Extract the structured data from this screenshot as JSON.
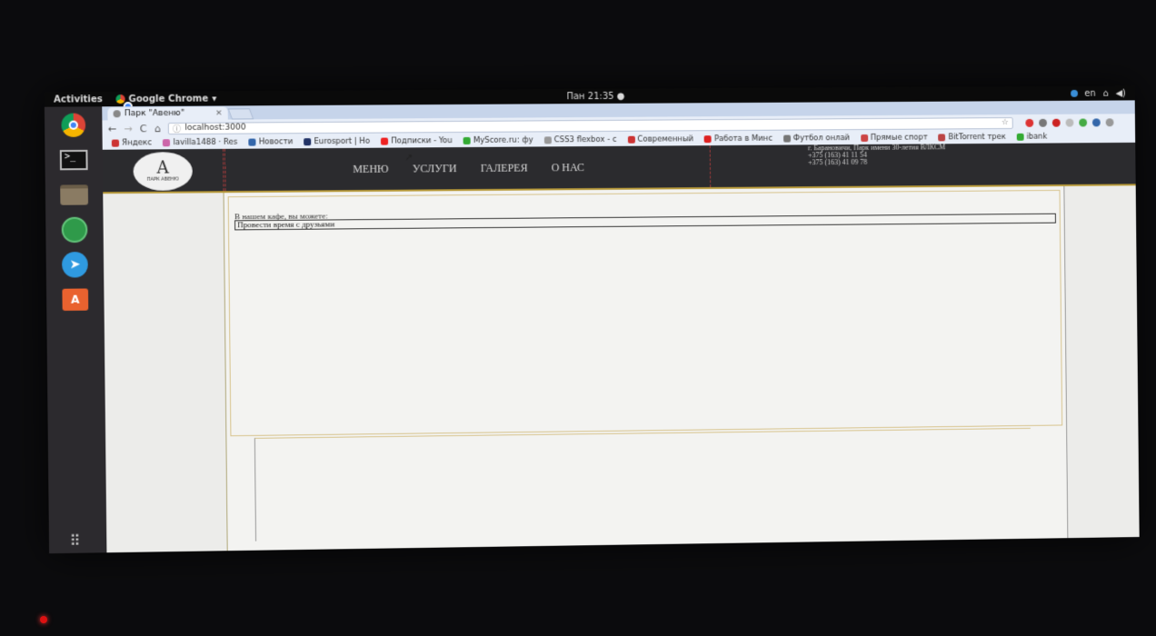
{
  "topbar": {
    "activities": "Activities",
    "app_name": "Google Chrome",
    "clock": "Пан 21:35 ●",
    "keyboard_layout": "en"
  },
  "dock": {
    "items": [
      "chrome-icon",
      "terminal-icon",
      "files-icon",
      "green-app-icon",
      "telegram-icon",
      "software-store-icon"
    ],
    "terminal_glyph": ">_",
    "store_glyph": "A",
    "apps_glyph": "⠿"
  },
  "browser": {
    "tab_title": "Парк \"Авеню\"",
    "tab_close": "×",
    "url": "localhost:3000",
    "bookmarks": [
      "Яндекс",
      "lavilla1488 · Res",
      "Новости",
      "Eurosport | Ho",
      "Подписки - You",
      "MyScore.ru: фу",
      "CSS3 flexbox - c",
      "Современный",
      "Работа в Минс",
      "Футбол онлай",
      "Прямые спорт",
      "BitTorrent трек",
      "ibank"
    ]
  },
  "site": {
    "logo_mark": "A",
    "logo_text": "ПАРК АВЕНЮ",
    "nav": [
      "МЕНЮ",
      "УСЛУГИ",
      "ГАЛЕРЕЯ",
      "О НАС"
    ],
    "address": "г. Барановичи, Парк имени 30-летия ВЛКСМ",
    "phone1": "+375 (163) 41 11 54",
    "phone2": "+375 (163) 41 09 78",
    "lead_text": "В нашем кафе, вы можете:",
    "list_item": "Провести время с друзьями"
  }
}
